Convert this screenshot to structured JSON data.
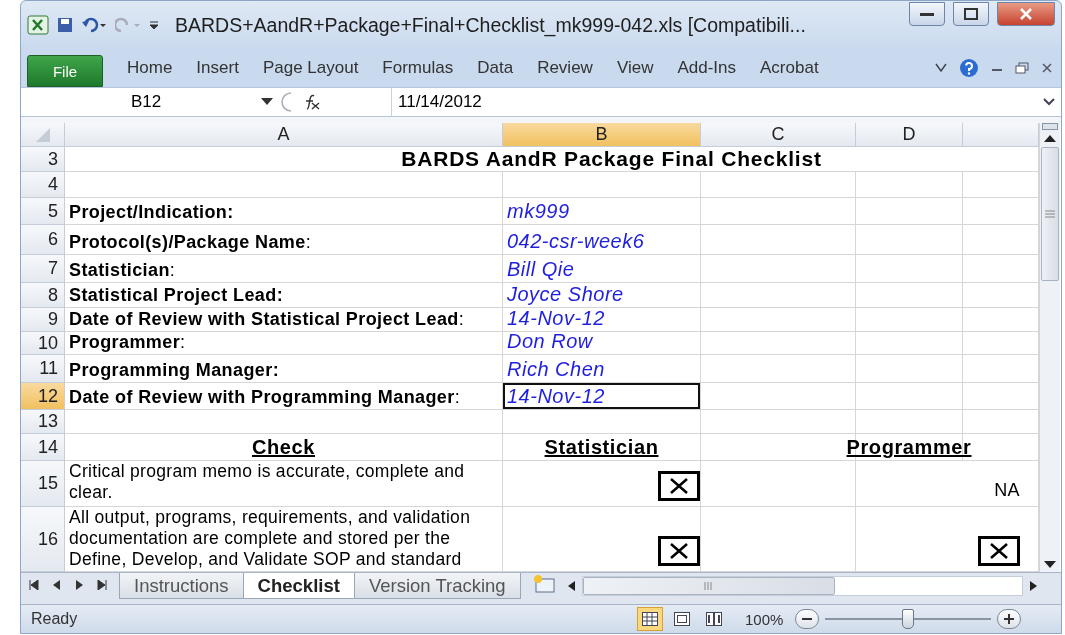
{
  "window": {
    "title": "BARDS+AandR+Package+Final+Checklist_mk999-042.xls  [Compatibili..."
  },
  "ribbon": {
    "tabs": [
      {
        "label": "File",
        "kind": "file",
        "selected": false
      },
      {
        "label": "Home",
        "kind": "tab",
        "selected": false
      },
      {
        "label": "Insert",
        "kind": "tab",
        "selected": false
      },
      {
        "label": "Page Layout",
        "kind": "tab",
        "selected": false
      },
      {
        "label": "Formulas",
        "kind": "tab",
        "selected": false
      },
      {
        "label": "Data",
        "kind": "tab",
        "selected": false
      },
      {
        "label": "Review",
        "kind": "tab",
        "selected": false
      },
      {
        "label": "View",
        "kind": "tab",
        "selected": false
      },
      {
        "label": "Add-Ins",
        "kind": "tab",
        "selected": false
      },
      {
        "label": "Acrobat",
        "kind": "tab",
        "selected": false
      }
    ]
  },
  "formula_bar": {
    "name_box": "B12",
    "formula": "11/14/2012"
  },
  "sheet": {
    "columns": [
      {
        "label": "A",
        "selected": false
      },
      {
        "label": "B",
        "selected": true
      },
      {
        "label": "C",
        "selected": false
      },
      {
        "label": "D",
        "selected": false
      }
    ],
    "rows": [
      {
        "number": "3",
        "kind": "title",
        "selected": false,
        "text": "BARDS AandR Package Final Checklist"
      },
      {
        "number": "4",
        "kind": "blank",
        "selected": false
      },
      {
        "number": "5",
        "kind": "info",
        "selected": false,
        "label": "Project/Indication:",
        "value": "mk999",
        "value_selected": false
      },
      {
        "number": "6",
        "kind": "info",
        "selected": false,
        "label": "**Protocol(s)/Package Name**:",
        "value": "042-csr-week6",
        "value_selected": false
      },
      {
        "number": "7",
        "kind": "info",
        "selected": false,
        "label": "**Statistician**:",
        "value": "Bill Qie",
        "value_selected": false
      },
      {
        "number": "8",
        "kind": "info",
        "selected": false,
        "label": "Statistical Project Lead:",
        "value": "Joyce Shore",
        "value_selected": false
      },
      {
        "number": "9",
        "kind": "info",
        "selected": false,
        "label": "**Date of Review with Statistical Project Lead**:",
        "value": "14-Nov-12",
        "value_selected": false
      },
      {
        "number": "10",
        "kind": "info",
        "selected": false,
        "label": "**Programmer**:",
        "value": "Don Row",
        "value_selected": false
      },
      {
        "number": "11",
        "kind": "info",
        "selected": false,
        "label": "Programming Manager:",
        "value": "Rich Chen",
        "value_selected": false
      },
      {
        "number": "12",
        "kind": "info",
        "selected": true,
        "label": "**Date of Review with Programming Manager**:",
        "value": "14-Nov-12",
        "value_selected": true
      },
      {
        "number": "13",
        "kind": "blank",
        "selected": false
      },
      {
        "number": "14",
        "kind": "header",
        "selected": false,
        "check": "Check",
        "statistician": "Statistician",
        "programmer": "Programmer"
      },
      {
        "number": "15",
        "kind": "check",
        "selected": false,
        "text": "Critical program memo is accurate, complete and clear.",
        "statistician": {
          "kind": "checkbox",
          "checked": true
        },
        "programmer": {
          "kind": "text",
          "text": "NA"
        }
      },
      {
        "number": "16",
        "kind": "check",
        "selected": false,
        "text": "All output, programs, requirements, and validation documentation are complete and stored per the Define, Develop, and Validate SOP and standard",
        "statistician": {
          "kind": "checkbox",
          "checked": true
        },
        "programmer": {
          "kind": "checkbox",
          "checked": true
        }
      }
    ]
  },
  "sheet_tabs": [
    {
      "label": "Instructions",
      "selected": false
    },
    {
      "label": "Checklist",
      "selected": true
    },
    {
      "label": "Version Tracking",
      "selected": false
    }
  ],
  "status_bar": {
    "status": "Ready",
    "views": [
      {
        "kind": "normal",
        "selected": true
      },
      {
        "kind": "page-layout",
        "selected": false
      },
      {
        "kind": "page-break",
        "selected": false
      }
    ],
    "zoom": "100%",
    "zoom_slider": {
      "level": 0.5
    }
  }
}
